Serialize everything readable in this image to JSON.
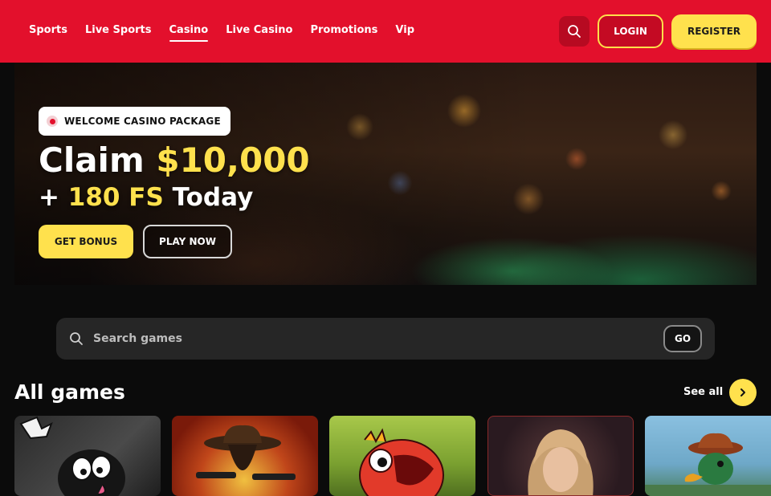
{
  "header": {
    "nav": [
      "Sports",
      "Live Sports",
      "Casino",
      "Live Casino",
      "Promotions",
      "Vip"
    ],
    "active_nav": "Casino",
    "login_label": "LOGIN",
    "register_label": "REGISTER"
  },
  "hero": {
    "badge": "WELCOME CASINO PACKAGE",
    "line1_prefix": "Claim ",
    "line1_amount": "$10,000",
    "line2_prefix": "+ ",
    "line2_fs": "180 FS",
    "line2_suffix": " Today",
    "get_bonus_label": "GET BONUS",
    "play_now_label": "PLAY NOW"
  },
  "search": {
    "placeholder": "Search games",
    "value": "",
    "go_label": "GO"
  },
  "games": {
    "title": "All games",
    "see_all_label": "See all"
  },
  "colors": {
    "brand_red": "#e3102c",
    "accent_yellow": "#ffe14d",
    "background": "#0b0b0b"
  }
}
